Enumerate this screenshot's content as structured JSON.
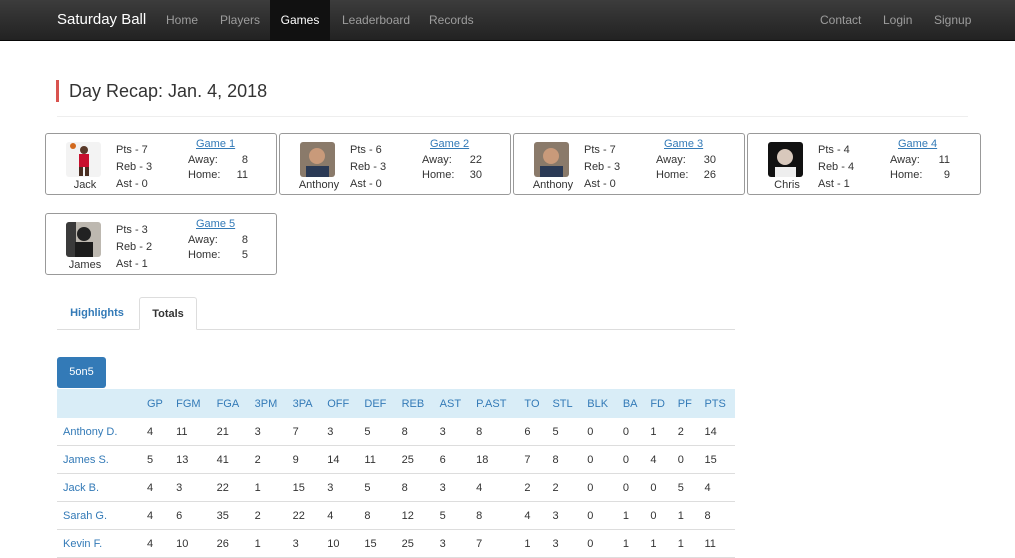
{
  "nav": {
    "brand": "Saturday Ball",
    "links": [
      "Home",
      "Players",
      "Games",
      "Leaderboard",
      "Records"
    ],
    "active": "Games",
    "right_links": [
      "Contact",
      "Login",
      "Signup"
    ]
  },
  "page": {
    "title": "Day Recap: Jan. 4, 2018"
  },
  "games": [
    {
      "player": "Jack",
      "pts": "Pts - 7",
      "reb": "Reb - 3",
      "ast": "Ast - 0",
      "game": "Game 1",
      "away_label": "Away:",
      "away": "8",
      "home_label": "Home:",
      "home": "11"
    },
    {
      "player": "Anthony",
      "pts": "Pts - 6",
      "reb": "Reb - 3",
      "ast": "Ast - 0",
      "game": "Game 2",
      "away_label": "Away:",
      "away": "22",
      "home_label": "Home:",
      "home": "30"
    },
    {
      "player": "Anthony",
      "pts": "Pts - 7",
      "reb": "Reb - 3",
      "ast": "Ast - 0",
      "game": "Game 3",
      "away_label": "Away:",
      "away": "30",
      "home_label": "Home:",
      "home": "26"
    },
    {
      "player": "Chris",
      "pts": "Pts - 4",
      "reb": "Reb - 4",
      "ast": "Ast - 1",
      "game": "Game 4",
      "away_label": "Away:",
      "away": "11",
      "home_label": "Home:",
      "home": "9"
    },
    {
      "player": "James",
      "pts": "Pts - 3",
      "reb": "Reb - 2",
      "ast": "Ast - 1",
      "game": "Game 5",
      "away_label": "Away:",
      "away": "8",
      "home_label": "Home:",
      "home": "5"
    }
  ],
  "tabs": [
    "Highlights",
    "Totals"
  ],
  "active_tab": "Totals",
  "mode_button": "5on5",
  "table": {
    "headers": [
      "",
      "GP",
      "FGM",
      "FGA",
      "3PM",
      "3PA",
      "OFF",
      "DEF",
      "REB",
      "AST",
      "P.AST",
      "TO",
      "STL",
      "BLK",
      "BA",
      "FD",
      "PF",
      "PTS"
    ],
    "rows": [
      [
        "Anthony D.",
        "4",
        "11",
        "21",
        "3",
        "7",
        "3",
        "5",
        "8",
        "3",
        "8",
        "6",
        "5",
        "0",
        "0",
        "1",
        "2",
        "14"
      ],
      [
        "James S.",
        "5",
        "13",
        "41",
        "2",
        "9",
        "14",
        "11",
        "25",
        "6",
        "18",
        "7",
        "8",
        "0",
        "0",
        "4",
        "0",
        "15"
      ],
      [
        "Jack B.",
        "4",
        "3",
        "22",
        "1",
        "15",
        "3",
        "5",
        "8",
        "3",
        "4",
        "2",
        "2",
        "0",
        "0",
        "0",
        "5",
        "4"
      ],
      [
        "Sarah G.",
        "4",
        "6",
        "35",
        "2",
        "22",
        "4",
        "8",
        "12",
        "5",
        "8",
        "4",
        "3",
        "0",
        "1",
        "0",
        "1",
        "8"
      ],
      [
        "Kevin F.",
        "4",
        "10",
        "26",
        "1",
        "3",
        "10",
        "15",
        "25",
        "3",
        "7",
        "1",
        "3",
        "0",
        "1",
        "1",
        "1",
        "11"
      ]
    ]
  },
  "colors": {
    "accent": "#337ab7",
    "title_bar": "#d9534f",
    "navbar": "#222222",
    "table_head": "#d9edf7"
  }
}
